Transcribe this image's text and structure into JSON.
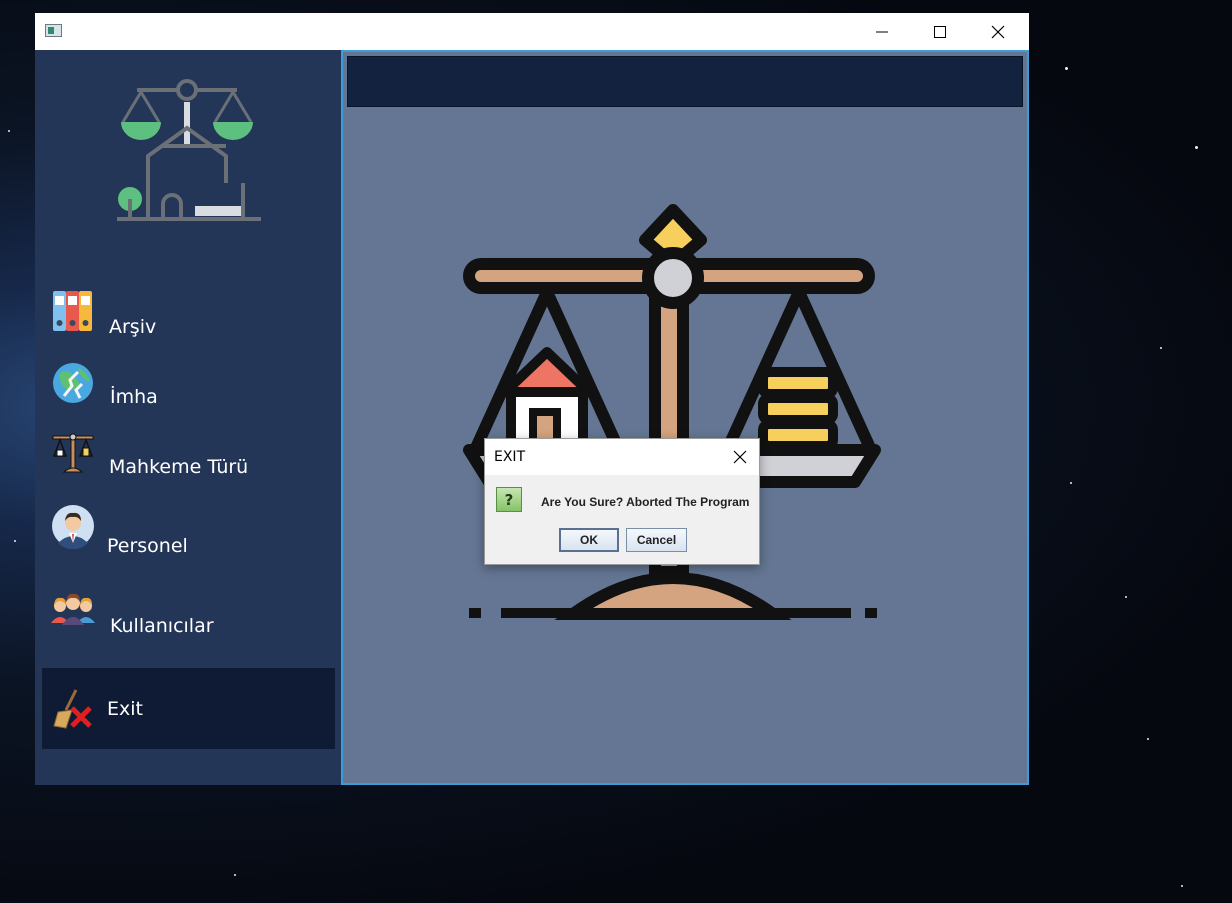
{
  "window": {
    "title": "",
    "controls": [
      "minimize-icon",
      "maximize-icon",
      "close-icon"
    ]
  },
  "sidebar": {
    "items": [
      {
        "label": "Arşiv",
        "icon": "binders-icon"
      },
      {
        "label": "İmha",
        "icon": "shredded-globe-icon"
      },
      {
        "label": "Mahkeme Türü",
        "icon": "scale-icon"
      },
      {
        "label": "Personel",
        "icon": "person-icon"
      },
      {
        "label": "Kullanıcılar",
        "icon": "users-icon"
      },
      {
        "label": "Exit",
        "icon": "broom-cross-icon",
        "active": true
      }
    ]
  },
  "dialog": {
    "title": "EXIT",
    "icon": "question-icon",
    "message": "Are You Sure?  Aborted The Program",
    "ok_label": "OK",
    "cancel_label": "Cancel"
  },
  "colors": {
    "sidebar_bg": "#233658",
    "active_item_bg": "#0f1b34",
    "main_bg": "#647693",
    "main_border": "#3a9fd6",
    "header_bar": "#13223f"
  }
}
